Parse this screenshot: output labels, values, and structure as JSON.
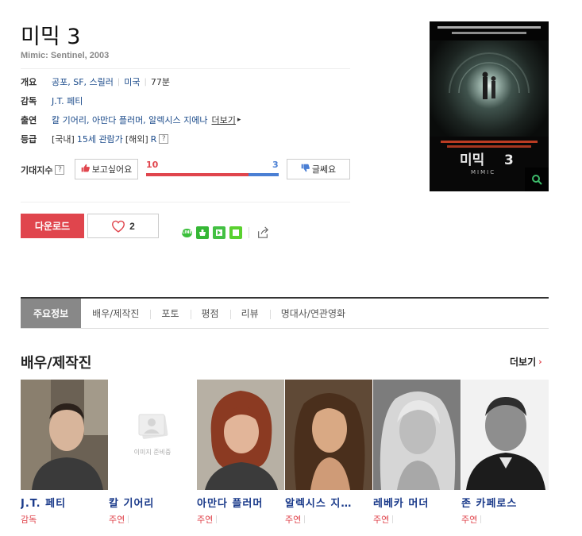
{
  "movie": {
    "title": "미믹 3",
    "subtitle": "Mimic: Sentinel, 2003"
  },
  "info": {
    "genre_label": "개요",
    "genres": "공포, SF, 스릴러",
    "country": "미국",
    "runtime": "77분",
    "director_label": "감독",
    "director": "J.T. 페티",
    "cast_label": "출연",
    "cast_names": "칼 기어리, 아만다 플러머, 알렉시스 지에나",
    "cast_more": "더보기",
    "rating_label": "등급",
    "rating_domestic_prefix": "[국내]",
    "rating_domestic": "15세 관람가",
    "rating_foreign_prefix": "[해외]",
    "rating_foreign": "R",
    "rating_help": "?"
  },
  "expect": {
    "label": "기대지수",
    "help": "?",
    "want_label": "보고싶어요",
    "bad_label": "글쎄요",
    "want_count": "10",
    "bad_count": "3",
    "want_ratio": 0.77
  },
  "actions": {
    "download_label": "다운로드",
    "like_count": "2"
  },
  "share": {
    "line_label": "LINE"
  },
  "colors": {
    "accent": "#e0454d",
    "blue": "#4a7fd4",
    "link": "#1a4a8a"
  },
  "tabs": [
    {
      "label": "주요정보",
      "active": true
    },
    {
      "label": "배우/제작진"
    },
    {
      "label": "포토"
    },
    {
      "label": "평점"
    },
    {
      "label": "리뷰"
    },
    {
      "label": "명대사/연관영화"
    }
  ],
  "cast_section": {
    "title": "배우/제작진",
    "more_label": "더보기",
    "no_image_text": "이미지 준비중",
    "people": [
      {
        "name": "J.T. 페티",
        "role": "감독"
      },
      {
        "name": "칼 기어리",
        "role": "주연"
      },
      {
        "name": "아만다 플러머",
        "role": "주연"
      },
      {
        "name": "알렉시스 지…",
        "role": "주연"
      },
      {
        "name": "레베카 머더",
        "role": "주연"
      },
      {
        "name": "존 카페로스",
        "role": "주연"
      }
    ]
  }
}
